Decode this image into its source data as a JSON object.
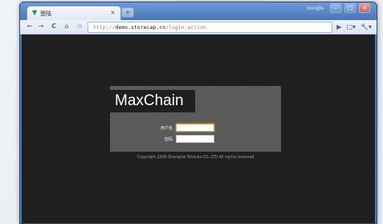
{
  "browser": {
    "tab": {
      "title": "登陆"
    },
    "google_label": "Google",
    "window_controls": [
      "–",
      "□",
      "×"
    ],
    "omnibox": {
      "scheme": "http://",
      "host": "demo.storecap.cn",
      "path": "/login.action"
    },
    "nav": {
      "back": "←",
      "forward": "→",
      "reload": "C",
      "home": "⌂",
      "star": "☆"
    }
  },
  "page": {
    "brand": "MaxChain",
    "form": {
      "username_label": "用户名",
      "password_label": "密码"
    },
    "copyright": "Copyright 2009 Shanghai Totacks CO.,LTD All rights reserved"
  },
  "colors": {
    "frame_blue": "#4f79b4",
    "page_bg": "#1f1f1f",
    "panel_bg": "#5a5a5a",
    "focus_orange": "#e9a437"
  }
}
